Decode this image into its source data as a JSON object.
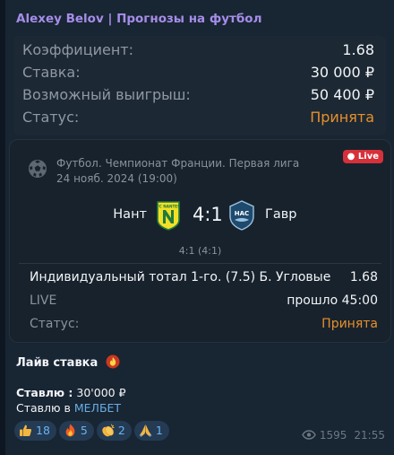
{
  "message": {
    "sender": "Alexey Belov | Прогнозы на футбол",
    "bet": {
      "odds_label": "Коэффициент:",
      "odds_value": "1.68",
      "stake_label": "Ставка:",
      "stake_value": "30 000 ₽",
      "payout_label": "Возможный выигрыш:",
      "payout_value": "50 400 ₽",
      "status_label": "Статус:",
      "status_value": "Принята"
    },
    "event": {
      "league": "Футбол. Чемпионат Франции. Первая лига",
      "date": "24 нояб. 2024 (19:00)",
      "live_badge": "Live",
      "home_team": "Нант",
      "home_logo_text": "FC NANTES",
      "score": "4:1",
      "away_team": "Гавр",
      "away_logo_text": "HAC",
      "halftime": "4:1 (4:1)",
      "market": "Индивидуальный тотал 1-го. (7.5) Б. Угловые",
      "market_odds": "1.68",
      "live_label": "LIVE",
      "elapsed": "прошло 45:00",
      "status_label": "Статус:",
      "status_value": "Принята"
    },
    "caption": "Лайв ставка",
    "stake_line_label": "Ставлю :",
    "stake_line_value": " 30'000 ₽",
    "bookmaker_prefix": "Ставлю в ",
    "bookmaker_link": "МЕЛБЕТ",
    "reactions": [
      {
        "icon": "thumbs-up-icon",
        "count": "18"
      },
      {
        "icon": "fire-icon",
        "count": "5"
      },
      {
        "icon": "clapping-hands-icon",
        "count": "2"
      },
      {
        "icon": "praying-hands-icon",
        "count": "1"
      }
    ],
    "views": "1595",
    "time": "21:55"
  },
  "colors": {
    "background": "#0e1621",
    "bubble": "#182533",
    "sender_name": "#a58de8",
    "status_accepted": "#e6902d",
    "live_badge": "#d6303a",
    "link": "#68aee6",
    "reaction_bg": "#243b53"
  }
}
